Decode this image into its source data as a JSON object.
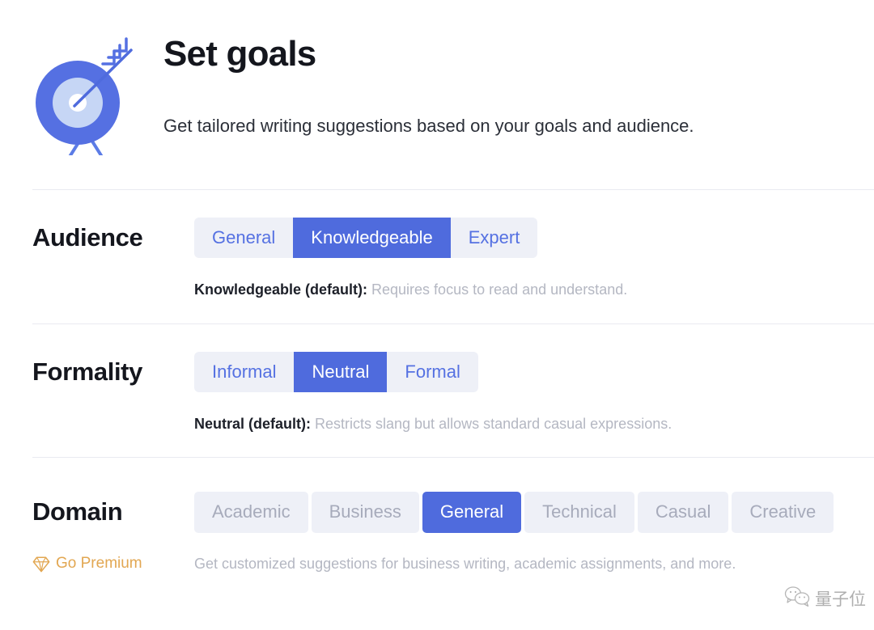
{
  "header": {
    "icon": "target-arrow-icon",
    "title": "Set goals",
    "subtitle": "Get tailored writing suggestions based on your goals and audience."
  },
  "settings": [
    {
      "id": "audience",
      "label": "Audience",
      "style": "joined",
      "options": [
        {
          "label": "General",
          "selected": false,
          "disabled": false
        },
        {
          "label": "Knowledgeable",
          "selected": true,
          "disabled": false
        },
        {
          "label": "Expert",
          "selected": false,
          "disabled": false
        }
      ],
      "description_lead": "Knowledgeable (default):",
      "description_text": " Requires focus to read and understand."
    },
    {
      "id": "formality",
      "label": "Formality",
      "style": "joined",
      "options": [
        {
          "label": "Informal",
          "selected": false,
          "disabled": false
        },
        {
          "label": "Neutral",
          "selected": true,
          "disabled": false
        },
        {
          "label": "Formal",
          "selected": false,
          "disabled": false
        }
      ],
      "description_lead": "Neutral (default):",
      "description_text": " Restricts slang but allows standard casual expressions."
    },
    {
      "id": "domain",
      "label": "Domain",
      "style": "split",
      "options": [
        {
          "label": "Academic",
          "selected": false,
          "disabled": true
        },
        {
          "label": "Business",
          "selected": false,
          "disabled": true
        },
        {
          "label": "General",
          "selected": true,
          "disabled": false
        },
        {
          "label": "Technical",
          "selected": false,
          "disabled": true
        },
        {
          "label": "Casual",
          "selected": false,
          "disabled": true
        },
        {
          "label": "Creative",
          "selected": false,
          "disabled": true
        }
      ],
      "premium_label": "Go Premium",
      "premium_icon": "diamond-icon",
      "description_lead": "",
      "description_text": "Get customized suggestions for business writing, academic assignments, and more."
    }
  ],
  "watermark": {
    "icon": "wechat-icon",
    "text": "量子位"
  },
  "colors": {
    "accent_blue": "#4f6bdd",
    "segment_text_blue": "#5571e2",
    "segment_bg": "#eef0f7",
    "disabled_text": "#a7abbb",
    "premium_gold": "#e2a752",
    "title": "#14161d",
    "muted_text": "#b4b7c2",
    "divider": "#e9eaf1"
  }
}
